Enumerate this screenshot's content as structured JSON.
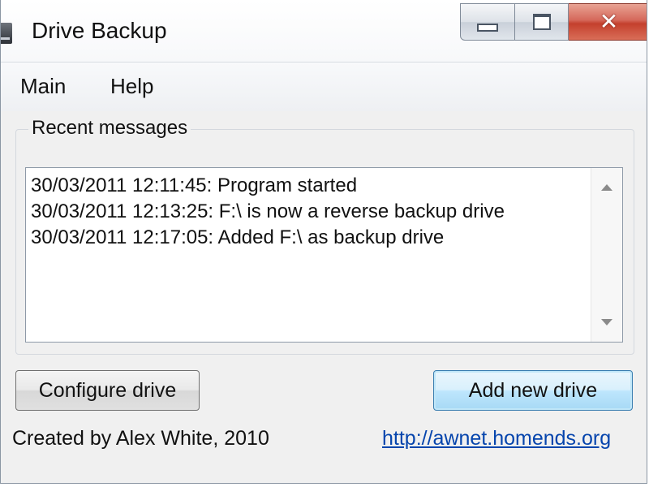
{
  "window": {
    "title": "Drive Backup",
    "icon": "drive-icon",
    "caption_buttons": {
      "minimize_icon": "minimize-icon",
      "maximize_icon": "maximize-icon",
      "close_icon": "close-icon",
      "close_glyph": "✕"
    }
  },
  "menu": {
    "items": [
      "Main",
      "Help"
    ]
  },
  "messages": {
    "group_label": "Recent messages",
    "lines": [
      "30/03/2011 12:11:45: Program started",
      "30/03/2011 12:13:25: F:\\ is now a reverse backup drive",
      "30/03/2011 12:17:05: Added F:\\ as backup drive"
    ]
  },
  "buttons": {
    "configure_label": "Configure drive",
    "add_label": "Add new drive"
  },
  "footer": {
    "credit": "Created by Alex White, 2010",
    "link": "http://awnet.homends.org"
  },
  "colors": {
    "link": "#0645ad",
    "close_button": "#c4402d",
    "default_button_border": "#3c7fb1"
  }
}
